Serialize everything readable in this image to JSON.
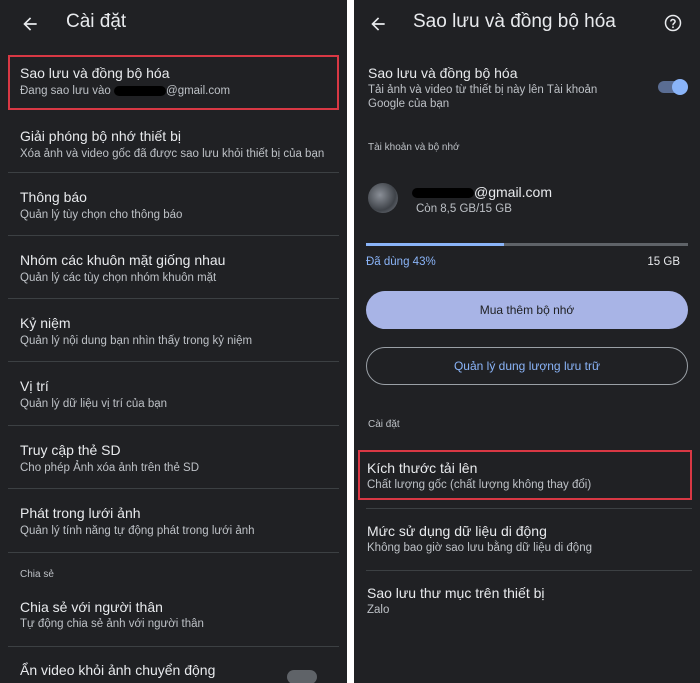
{
  "left": {
    "title": "Cài đặt",
    "items": [
      {
        "title": "Sao lưu và đồng bộ hóa",
        "subtitle_prefix": "Đang sao lưu vào",
        "subtitle_suffix": "@gmail.com"
      },
      {
        "title": "Giải phóng bộ nhớ thiết bị",
        "subtitle": "Xóa ảnh và video gốc đã được sao lưu khỏi thiết bị của bạn"
      },
      {
        "title": "Thông báo",
        "subtitle": "Quản lý tùy chọn cho thông báo"
      },
      {
        "title": "Nhóm các khuôn mặt giống nhau",
        "subtitle": "Quản lý các tùy chọn nhóm khuôn mặt"
      },
      {
        "title": "Kỷ niệm",
        "subtitle": "Quản lý nội dung bạn nhìn thấy trong kỷ niệm"
      },
      {
        "title": "Vị trí",
        "subtitle": "Quản lý dữ liệu vị trí của bạn"
      },
      {
        "title": "Truy cập thẻ SD",
        "subtitle": "Cho phép Ảnh xóa ảnh trên thẻ SD"
      },
      {
        "title": "Phát trong lưới ảnh",
        "subtitle": "Quản lý tính năng tự động phát trong lưới ảnh"
      }
    ],
    "section_share": "Chia sẻ",
    "share_item": {
      "title": "Chia sẻ với người thân",
      "subtitle": "Tự động chia sẻ ảnh với người thân"
    },
    "last_item": {
      "title": "Ẩn video khỏi ảnh chuyển động"
    }
  },
  "right": {
    "title": "Sao lưu và đồng bộ hóa",
    "backup": {
      "title": "Sao lưu và đồng bộ hóa",
      "subtitle_line1": "Tải ảnh và video từ thiết bị này lên Tài khoản",
      "subtitle_line2": "Google của bạn",
      "enabled": true
    },
    "section_account": "Tài khoản và bộ nhớ",
    "account": {
      "email_suffix": "@gmail.com",
      "remaining": "Còn 8,5 GB/15 GB"
    },
    "storage": {
      "used_label": "Đã dùng 43%",
      "total": "15 GB",
      "used_fraction": 0.43
    },
    "buy_button": "Mua thêm bộ nhớ",
    "manage_button": "Quản lý dung lượng lưu trữ",
    "section_settings": "Cài đặt",
    "settings": [
      {
        "title": "Kích thước tải lên",
        "subtitle": "Chất lượng gốc (chất lượng không thay đổi)"
      },
      {
        "title": "Mức sử dụng dữ liệu di động",
        "subtitle": "Không bao giờ sao lưu bằng dữ liệu di động"
      },
      {
        "title": "Sao lưu thư mục trên thiết bị",
        "subtitle": "Zalo"
      }
    ],
    "colors": {
      "accent": "#8ab4f8",
      "button_fill": "#a8b4e6",
      "highlight": "#d93844"
    }
  }
}
